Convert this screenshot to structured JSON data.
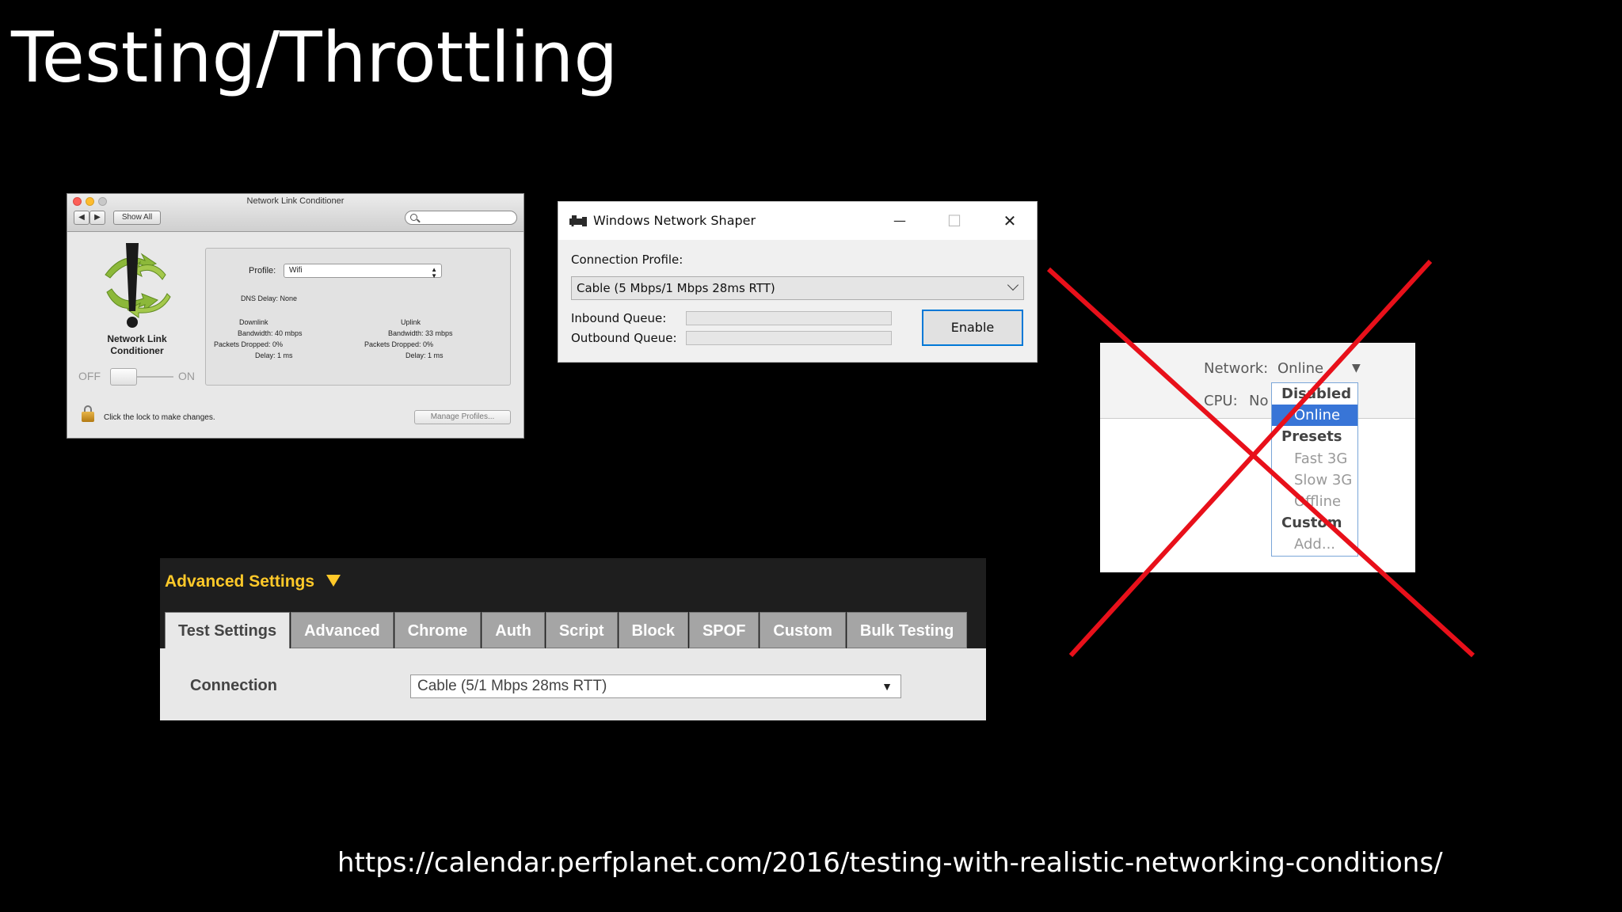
{
  "slide": {
    "title": "Testing/Throttling",
    "footer_url": "https://calendar.perfplanet.com/2016/testing-with-realistic-networking-conditions/"
  },
  "mac_nlc": {
    "window_title": "Network Link Conditioner",
    "show_all": "Show All",
    "logo_label_line1": "Network Link",
    "logo_label_line2": "Conditioner",
    "switch_off": "OFF",
    "switch_on": "ON",
    "profile_label": "Profile:",
    "profile_value": "Wifi",
    "dns_delay": "DNS Delay: None",
    "downlink": {
      "heading": "Downlink",
      "bandwidth": "Bandwidth: 40 mbps",
      "packets_dropped": "Packets Dropped: 0%",
      "delay": "Delay: 1 ms"
    },
    "uplink": {
      "heading": "Uplink",
      "bandwidth": "Bandwidth: 33 mbps",
      "packets_dropped": "Packets Dropped: 0%",
      "delay": "Delay: 1 ms"
    },
    "lock_text": "Click the lock to make changes.",
    "manage_profiles": "Manage Profiles...",
    "colors": {
      "close": "#fc5f57",
      "minimize": "#fdbc2e",
      "zoom": "#c8c8c8"
    }
  },
  "windows_shaper": {
    "window_title": "Windows Network Shaper",
    "minimize_glyph": "—",
    "maximize_glyph": "☐",
    "close_glyph": "✕",
    "connection_profile_label": "Connection Profile:",
    "connection_profile_value": "Cable (5 Mbps/1 Mbps 28ms RTT)",
    "inbound_label": "Inbound Queue:",
    "outbound_label": "Outbound Queue:",
    "inbound_fill": 0,
    "outbound_fill": 0,
    "enable_button": "Enable"
  },
  "chrome_throttle": {
    "network_label": "Network:",
    "network_value": "Online",
    "cpu_label": "CPU:",
    "cpu_value": "No",
    "menu": [
      {
        "label": "Disabled",
        "kind": "group"
      },
      {
        "label": "Online",
        "kind": "selected"
      },
      {
        "label": "Presets",
        "kind": "group"
      },
      {
        "label": "Fast 3G",
        "kind": "option"
      },
      {
        "label": "Slow 3G",
        "kind": "option"
      },
      {
        "label": "Offline",
        "kind": "option"
      },
      {
        "label": "Custom",
        "kind": "group"
      },
      {
        "label": "Add...",
        "kind": "option"
      }
    ],
    "crossed_out": true,
    "cross_color": "#e8101a"
  },
  "webpagetest": {
    "header": "Advanced Settings",
    "tabs": [
      "Test Settings",
      "Advanced",
      "Chrome",
      "Auth",
      "Script",
      "Block",
      "SPOF",
      "Custom",
      "Bulk Testing"
    ],
    "active_tab": "Test Settings",
    "connection_label": "Connection",
    "connection_value": "Cable (5/1 Mbps 28ms RTT)",
    "accent_color": "#ffc929"
  }
}
